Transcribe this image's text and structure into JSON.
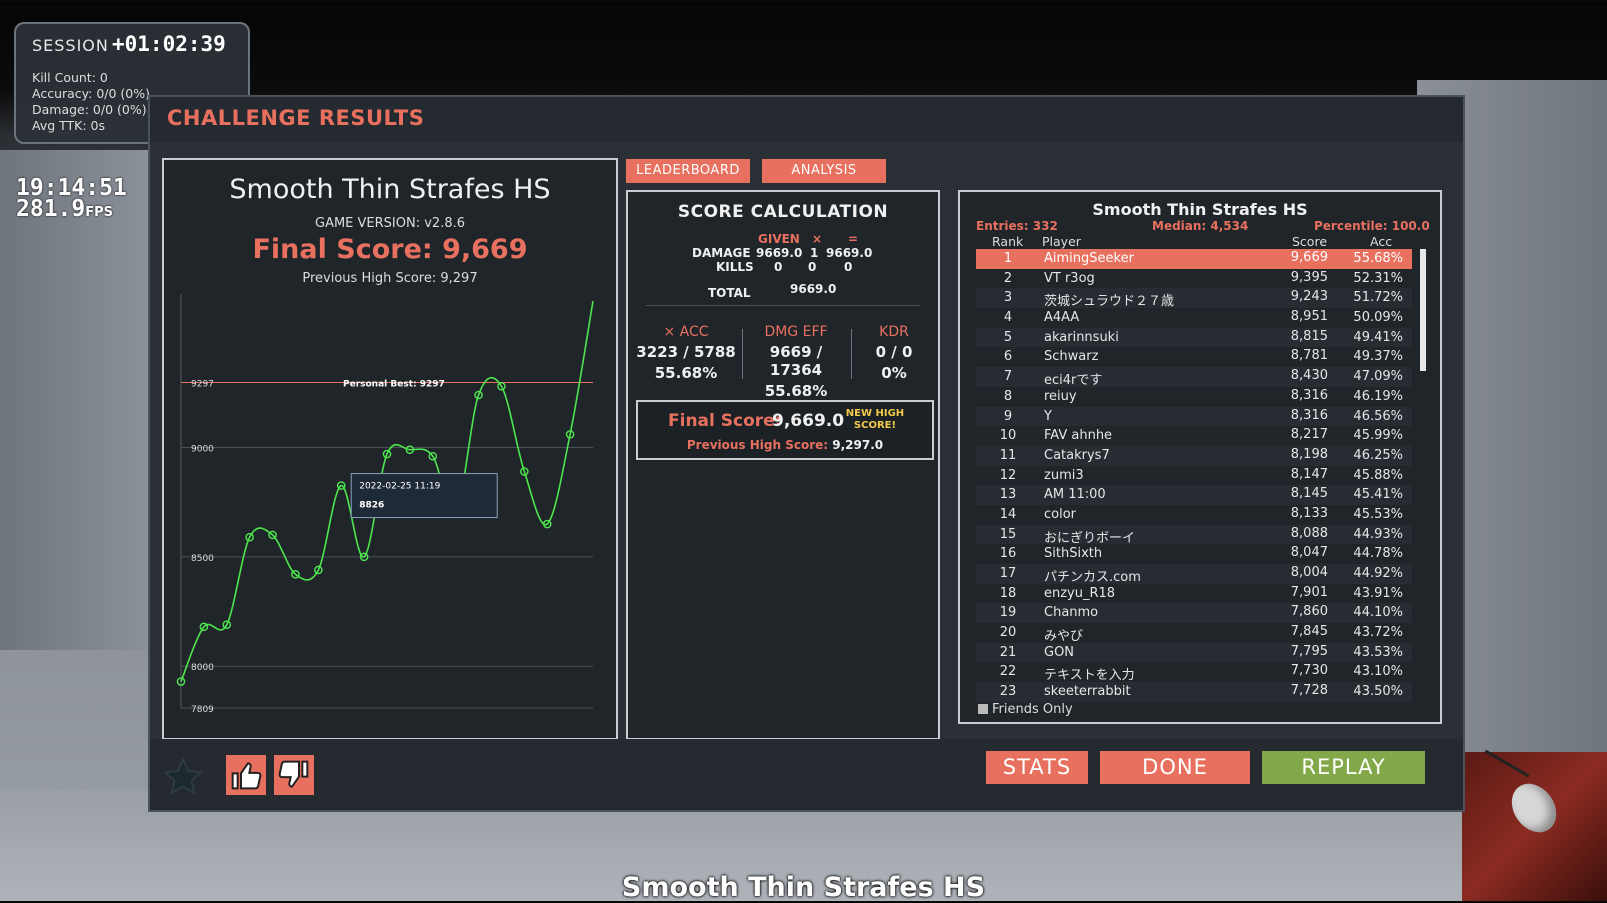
{
  "session": {
    "label": "SESSION",
    "time": "+01:02:39",
    "kill_count": "Kill Count: 0",
    "accuracy": "Accuracy: 0/0 (0%)",
    "damage": "Damage: 0/0 (0%)",
    "avg_ttk": "Avg TTK: 0s"
  },
  "clock": {
    "time": "19:14:51",
    "fps_value": "281.9",
    "fps_unit": "FPS"
  },
  "dialog": {
    "title": "CHALLENGE RESULTS"
  },
  "summary": {
    "scenario": "Smooth Thin Strafes HS",
    "version": "GAME VERSION: v2.8.6",
    "final_score": "Final Score: 9,669",
    "previous_high": "Previous High Score: 9,297"
  },
  "chart_data": {
    "type": "line",
    "y_ticks": [
      7809,
      8000,
      8500,
      9000,
      9297
    ],
    "ylim": [
      7809,
      9720
    ],
    "reference_line": {
      "value": 9297,
      "label": "Personal Best: 9297",
      "color": "#e8705f"
    },
    "series": [
      {
        "color": "#4ee64e",
        "values": [
          7930,
          8180,
          8190,
          8590,
          8600,
          8420,
          8440,
          8826,
          8500,
          8970,
          8990,
          8960,
          8700,
          9240,
          9280,
          8890,
          8650,
          9060,
          9669
        ]
      }
    ],
    "tooltip": {
      "date": "2022-02-25 11:19",
      "value": "8826"
    }
  },
  "tabs": {
    "leaderboard": "LEADERBOARD",
    "analysis": "ANALYSIS"
  },
  "calc": {
    "title": "SCORE CALCULATION",
    "col_given": "GIVEN",
    "col_mult": "×",
    "col_eq": "=",
    "damage_label": "DAMAGE",
    "damage_given": "9669.0",
    "damage_mult": "1",
    "damage_result": "9669.0",
    "kills_label": "KILLS",
    "kills_given": "0",
    "kills_mult": "0",
    "kills_result": "0",
    "total_label": "TOTAL",
    "total_value": "9669.0",
    "acc_label": "× ACC",
    "acc_value": "3223 / 5788",
    "acc_pct": "55.68%",
    "eff_label": "DMG EFF",
    "eff_value": "9669 / 17364",
    "eff_pct": "55.68%",
    "kdr_label": "KDR",
    "kdr_value": "0 / 0",
    "kdr_pct": "0%",
    "final_label": "Final Score:",
    "final_value": "9,669.0",
    "new_high": "NEW HIGH SCORE!",
    "prev_label": "Previous High Score:",
    "prev_value": "9,297.0"
  },
  "leaderboard": {
    "title": "Smooth Thin Strafes HS",
    "entries": "Entries: 332",
    "median": "Median: 4,534",
    "percentile": "Percentile: 100.0",
    "col_rank": "Rank",
    "col_player": "Player",
    "col_score": "Score",
    "col_acc": "Acc",
    "rows": [
      {
        "rank": "1",
        "player": "AimingSeeker",
        "score": "9,669",
        "acc": "55.68%"
      },
      {
        "rank": "2",
        "player": "VT r3og",
        "score": "9,395",
        "acc": "52.31%"
      },
      {
        "rank": "3",
        "player": "茨城シュラウド２７歳",
        "score": "9,243",
        "acc": "51.72%"
      },
      {
        "rank": "4",
        "player": "A4AA",
        "score": "8,951",
        "acc": "50.09%"
      },
      {
        "rank": "5",
        "player": "akarinnsuki",
        "score": "8,815",
        "acc": "49.41%"
      },
      {
        "rank": "6",
        "player": "Schwarz",
        "score": "8,781",
        "acc": "49.37%"
      },
      {
        "rank": "7",
        "player": "eci4rです",
        "score": "8,430",
        "acc": "47.09%"
      },
      {
        "rank": "8",
        "player": "reiuy",
        "score": "8,316",
        "acc": "46.19%"
      },
      {
        "rank": "9",
        "player": "Y",
        "score": "8,316",
        "acc": "46.56%"
      },
      {
        "rank": "10",
        "player": "FAV ahnhe",
        "score": "8,217",
        "acc": "45.99%"
      },
      {
        "rank": "11",
        "player": "Catakrys7",
        "score": "8,198",
        "acc": "46.25%"
      },
      {
        "rank": "12",
        "player": "zumi3",
        "score": "8,147",
        "acc": "45.88%"
      },
      {
        "rank": "13",
        "player": "AM 11:00",
        "score": "8,145",
        "acc": "45.41%"
      },
      {
        "rank": "14",
        "player": "color",
        "score": "8,133",
        "acc": "45.53%"
      },
      {
        "rank": "15",
        "player": "おにぎりボーイ",
        "score": "8,088",
        "acc": "44.93%"
      },
      {
        "rank": "16",
        "player": "SithSixth",
        "score": "8,047",
        "acc": "44.78%"
      },
      {
        "rank": "17",
        "player": "パチンカス.com",
        "score": "8,004",
        "acc": "44.92%"
      },
      {
        "rank": "18",
        "player": "enzyu_R18",
        "score": "7,901",
        "acc": "43.91%"
      },
      {
        "rank": "19",
        "player": "Chanmo",
        "score": "7,860",
        "acc": "44.10%"
      },
      {
        "rank": "20",
        "player": "みやび",
        "score": "7,845",
        "acc": "43.72%"
      },
      {
        "rank": "21",
        "player": "GON",
        "score": "7,795",
        "acc": "43.53%"
      },
      {
        "rank": "22",
        "player": "テキストを入力",
        "score": "7,730",
        "acc": "43.10%"
      },
      {
        "rank": "23",
        "player": "skeeterrabbit",
        "score": "7,728",
        "acc": "43.50%"
      }
    ],
    "friends_only": "Friends Only"
  },
  "buttons": {
    "stats": "STATS",
    "done": "DONE",
    "replay": "REPLAY"
  },
  "caption": "Smooth Thin Strafes HS",
  "colors": {
    "accent": "#e8705f",
    "line": "#4ee64e",
    "replay": "#83a84a",
    "new_high": "#f0c94a"
  }
}
